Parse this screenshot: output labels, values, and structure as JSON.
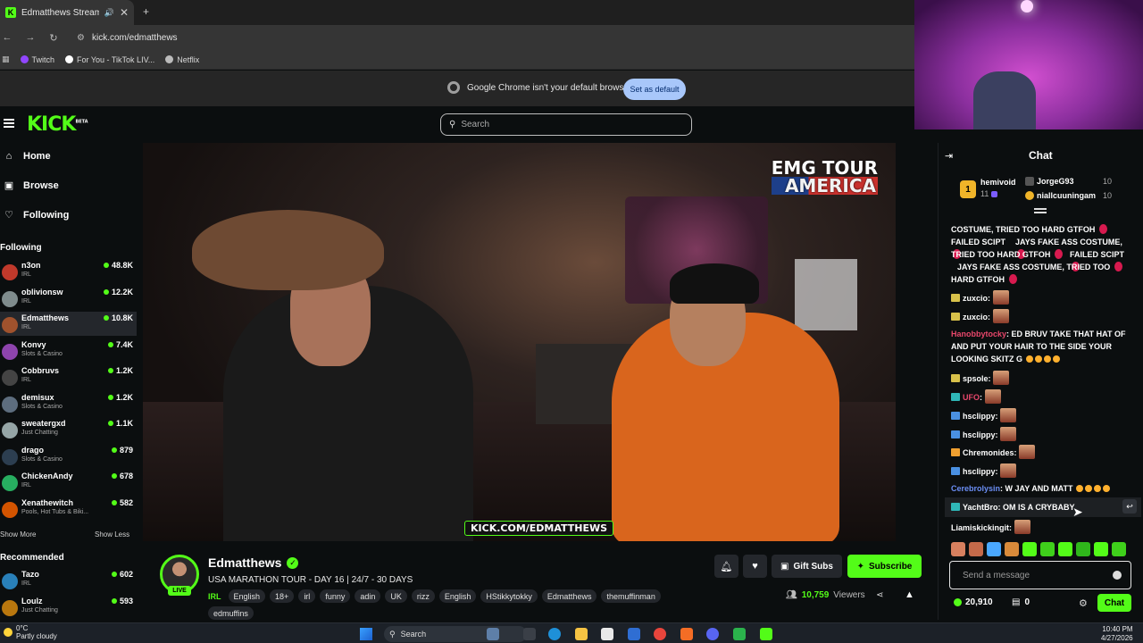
{
  "browser": {
    "tab_title": "Edmatthews Stream - Watc",
    "url": "kick.com/edmatthews",
    "bookmarks": [
      "Twitch",
      "For You - TikTok LIV...",
      "Netflix"
    ],
    "infobar_text": "Google Chrome isn't your default browser",
    "set_default_label": "Set as default"
  },
  "kick": {
    "logo": "KICK",
    "logo_sup": "BETA",
    "search_placeholder": "Search"
  },
  "sidebar": {
    "nav": [
      {
        "label": "Home",
        "icon": "home-icon"
      },
      {
        "label": "Browse",
        "icon": "browse-icon"
      },
      {
        "label": "Following",
        "icon": "heart-icon"
      }
    ],
    "following_header": "Following",
    "following": [
      {
        "name": "n3on",
        "category": "IRL",
        "viewers": "48.8K",
        "color": "#c0392b"
      },
      {
        "name": "oblivionsw",
        "category": "IRL",
        "viewers": "12.2K",
        "color": "#7f8c8d"
      },
      {
        "name": "Edmatthews",
        "category": "IRL",
        "viewers": "10.8K",
        "color": "#a0522d"
      },
      {
        "name": "Konvy",
        "category": "Slots & Casino",
        "viewers": "7.4K",
        "color": "#8e44ad"
      },
      {
        "name": "Cobbruvs",
        "category": "IRL",
        "viewers": "1.2K",
        "color": "#444444"
      },
      {
        "name": "demisux",
        "category": "Slots & Casino",
        "viewers": "1.2K",
        "color": "#5d6d7e"
      },
      {
        "name": "sweatergxd",
        "category": "Just Chatting",
        "viewers": "1.1K",
        "color": "#95a5a6"
      },
      {
        "name": "drago",
        "category": "Slots & Casino",
        "viewers": "879",
        "color": "#2c3e50"
      },
      {
        "name": "ChickenAndy",
        "category": "IRL",
        "viewers": "678",
        "color": "#27ae60"
      },
      {
        "name": "Xenathewitch",
        "category": "Pools, Hot Tubs & Biki...",
        "viewers": "582",
        "color": "#d35400"
      }
    ],
    "show_more": "Show More",
    "show_less": "Show Less",
    "recommended_header": "Recommended",
    "recommended": [
      {
        "name": "Tazo",
        "category": "IRL",
        "viewers": "602",
        "color": "#2980b9"
      },
      {
        "name": "Loulz",
        "category": "Just Chatting",
        "viewers": "593",
        "color": "#b9770e"
      }
    ]
  },
  "video": {
    "overlay_line1": "EMG TOUR",
    "overlay_line2": "AMERICA",
    "watermark": "KICK.COM/EDMATTHEWS"
  },
  "stream": {
    "name": "Edmatthews",
    "live": "LIVE",
    "title": "USA MARATHON TOUR - DAY 16 | 24/7 - 30 DAYS",
    "category": "IRL",
    "tags": [
      "English",
      "18+",
      "irl",
      "funny",
      "adin",
      "UK",
      "rizz",
      "English",
      "HStikkytokky",
      "Edmatthews",
      "themuffinman",
      "edmuffins"
    ],
    "gift_subs": "Gift Subs",
    "subscribe": "Subscribe",
    "viewer_count": "10,759",
    "viewers_label": "Viewers"
  },
  "chat": {
    "header": "Chat",
    "leaderboard": {
      "top": {
        "name": "hemivoid",
        "count": "11",
        "rank": "1"
      },
      "second": {
        "name": "JorgeG93",
        "count": "10"
      },
      "third": {
        "name": "niallcuuningam",
        "count": "10"
      }
    },
    "messages": [
      {
        "user": "",
        "color": "#ffffff",
        "text": "COSTUME, TRIED TOO HARD GTFOH"
      },
      {
        "user": "",
        "color": "#ffffff",
        "text": "FAILED SCIPT"
      },
      {
        "user": "",
        "color": "#ffffff",
        "text": "JAYS FAKE ASS COSTUME,"
      },
      {
        "user": "",
        "color": "#ffffff",
        "text": "TRIED TOO HARD GTFOH"
      },
      {
        "user": "",
        "color": "#ffffff",
        "text": "FAILED SCIPT"
      },
      {
        "user": "",
        "color": "#ffffff",
        "text": "JAYS FAKE ASS COSTUME, TRIED TOO"
      },
      {
        "user": "",
        "color": "#ffffff",
        "text": "HARD GTFOH"
      },
      {
        "user": "zuxcio",
        "color": "#ffffff",
        "text": ""
      },
      {
        "user": "zuxcio",
        "color": "#ffffff",
        "text": ""
      },
      {
        "user": "Hanobbytocky",
        "color": "#e8476b",
        "text": "ED BRUV TAKE THAT HAT OF AND PUT YOUR HAIR TO THE SIDE YOUR LOOKING SKITZ G"
      },
      {
        "user": "spsole",
        "color": "#ffffff",
        "text": ""
      },
      {
        "user": "UFO",
        "color": "#e8476b",
        "text": ""
      },
      {
        "user": "hsclippy",
        "color": "#ffffff",
        "text": ""
      },
      {
        "user": "hsclippy",
        "color": "#ffffff",
        "text": ""
      },
      {
        "user": "Chremonides",
        "color": "#ffffff",
        "text": ""
      },
      {
        "user": "hsclippy",
        "color": "#ffffff",
        "text": ""
      },
      {
        "user": "Cerebrolysin",
        "color": "#6b8ef5",
        "text": "W JAY AND MATT"
      },
      {
        "user": "YachtBro",
        "color": "#ffffff",
        "text": "OM IS A CRYBABY"
      },
      {
        "user": "Liamiskickingit",
        "color": "#ffffff",
        "text": ""
      }
    ],
    "send_placeholder": "Send a message",
    "points": "20,910",
    "gifts": "0",
    "chat_button": "Chat"
  },
  "taskbar": {
    "weather_temp": "0°C",
    "weather_desc": "Partly cloudy",
    "search": "Search",
    "time": "10:40 PM",
    "date": "4/27/2026"
  }
}
